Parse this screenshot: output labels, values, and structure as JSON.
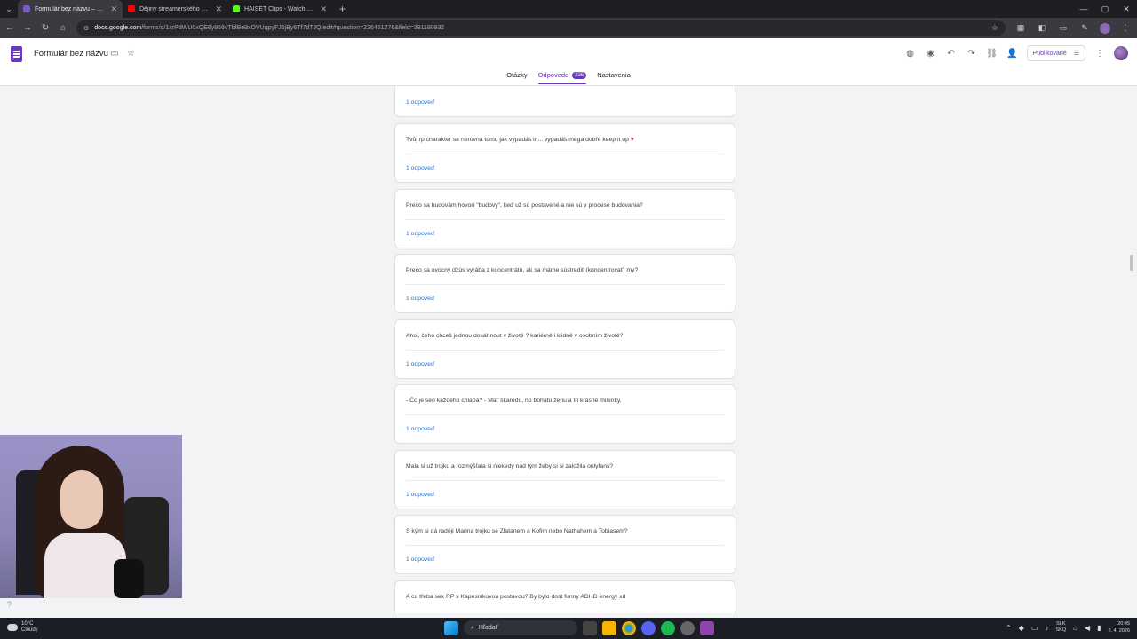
{
  "browser": {
    "tabs": [
      {
        "title": "Formulár bez názvu – Formulár",
        "favicon_color": "#7e57c2",
        "active": true
      },
      {
        "title": "Dějiny streamerského národa",
        "favicon_color": "#ff0000",
        "active": false
      },
      {
        "title": "HAISET Clips - Watch Live on K",
        "favicon_color": "#53fc18",
        "active": false
      }
    ],
    "url_host": "docs.google.com",
    "url_path": "/forms/d/1xrPdWU0xQE6y956vTbfBe9xOVUqpyFJ5jBy6Tf7dTJQ/edit#question=226451276&field=391190932"
  },
  "forms": {
    "title": "Formulár bez názvu",
    "publish_label": "Publikované",
    "tabs": {
      "questions": "Otázky",
      "responses": "Odpovede",
      "responses_count": "225",
      "settings": "Nastavenia"
    }
  },
  "responses": [
    {
      "text": "",
      "answer": "1 odpoveď"
    },
    {
      "text": "Tvůj rp charakter se nerovná tomu jak vypadáš irl... vypadáš mega dobře keep it up",
      "answer": "1 odpoveď"
    },
    {
      "text": "Prečo sa budovám hovorí \"budovy\", keď už sú postavené a nie sú v procese budovania?",
      "answer": "1 odpoveď"
    },
    {
      "text": "Prečo sa ovocný džús vyrába z koncentrátu, ak sa máme sústrediť (koncentrovať) my?",
      "answer": "1 odpoveď"
    },
    {
      "text": "Ahoj, čeho chceš jednou dosáhnout v životě ? kariérně i klidně v osobním životě?",
      "answer": "1 odpoveď"
    },
    {
      "text": "- Čo je sen každého chlapa? - Mať škaredú, no bohatú ženu a tri krásne milenky.",
      "answer": "1 odpoveď"
    },
    {
      "text": "Mala si už trojku a rozmýšľala si niekedy nad tým žeby si si založila onlyfans?",
      "answer": "1 odpoveď"
    },
    {
      "text": "S kým si dá raději Marina trojku se Zlatanem a Kofim nebo Nathahem a Tobiasem?",
      "answer": "1 odpoveď"
    },
    {
      "text": "A co třeba sex RP s Kapesnikovou postavou? By bylo dost funny ADHD energy xd",
      "answer": ""
    }
  ],
  "taskbar": {
    "weather_temp": "10°C",
    "weather_desc": "Cloudy",
    "search_placeholder": "Hľadať",
    "lang_top": "SLK",
    "lang_bottom": "SKQ",
    "time": "20:45",
    "date": "2. 4. 2026"
  },
  "icons": {
    "heart": "heart-icon",
    "colors": {
      "accent": "#673ab7",
      "link": "#1a73e8"
    }
  }
}
